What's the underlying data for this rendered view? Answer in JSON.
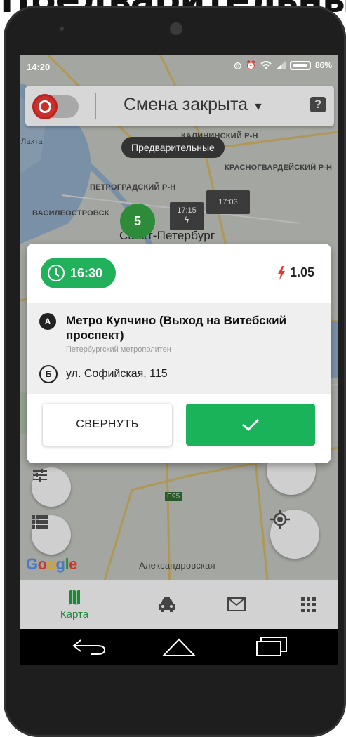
{
  "caption": {
    "text": "Предварительные"
  },
  "status_bar": {
    "time": "14:20",
    "battery": "86%"
  },
  "header": {
    "toggle_state": "off",
    "shift_title": "Смена закрыта",
    "help_label": "?"
  },
  "map": {
    "filter_pill": "Предварительные",
    "labels": {
      "lakhta": "Лахта",
      "kalininsky": "КАЛИНИНСКИЙ Р-Н",
      "krasnogvardeisky": "КРАСНОГВАРДЕЙСКИЙ Р-Н",
      "petrogradsky": "ПЕТРОГРАДСКИЙ Р-Н",
      "vasileostrovsky": "ВАСИЛЕОСТРОВСК",
      "city": "Санкт-Петербург",
      "road": "E95",
      "aleksandrovskaya": "Александровская"
    },
    "cluster_count": "5",
    "markers": [
      {
        "time": "17:15"
      },
      {
        "time": "17:03"
      }
    ],
    "google_logo": "Google"
  },
  "order_card": {
    "time": "16:30",
    "coefficient": "1.05",
    "point_a": {
      "marker": "А",
      "title": "Метро Купчино (Выход на Витебский проспект)",
      "subtitle": "Петербургский метрополитен"
    },
    "point_b": {
      "marker": "Б",
      "address": "ул. Софийская, 115"
    },
    "collapse_label": "СВЕРНУТЬ"
  },
  "bottom_nav": {
    "items": [
      {
        "label": "Карта",
        "icon": "map-icon",
        "active": true
      },
      {
        "label": "",
        "icon": "taxi-icon",
        "active": false
      },
      {
        "label": "",
        "icon": "mail-icon",
        "active": false
      },
      {
        "label": "",
        "icon": "grid-icon",
        "active": false
      }
    ]
  },
  "colors": {
    "accent_green": "#1ab35a",
    "nav_active": "#1c8a35",
    "bolt_red": "#e53935",
    "toggle_red": "#c8312b"
  }
}
